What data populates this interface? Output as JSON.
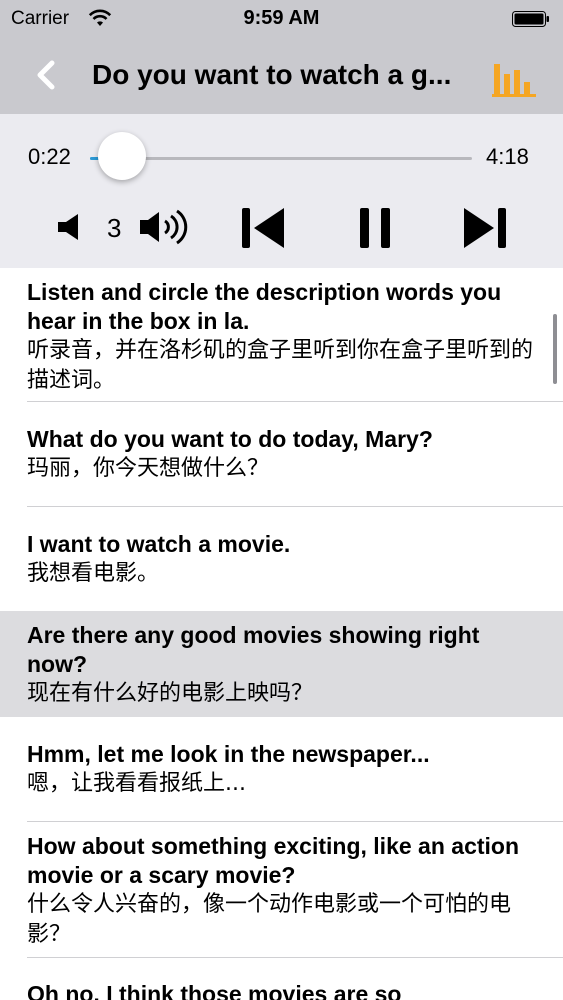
{
  "status_bar": {
    "carrier": "Carrier",
    "time": "9:59 AM"
  },
  "nav": {
    "title": "Do you want to watch a g...",
    "accent_color": "#f5a623"
  },
  "player": {
    "elapsed": "0:22",
    "total": "4:18",
    "progress": 0.085,
    "volume_level": "3"
  },
  "transcript": [
    {
      "en": "Listen and circle the description words you hear in the box in la.",
      "zh": "听录音，并在洛杉矶的盒子里听到你在盒子里听到的描述词。",
      "highlighted": false
    },
    {
      "en": "What do you want to do today, Mary?",
      "zh": "玛丽，你今天想做什么？",
      "highlighted": false
    },
    {
      "en": "I want to watch a movie.",
      "zh": "我想看电影。",
      "highlighted": false
    },
    {
      "en": "Are there any good movies showing right now?",
      "zh": "现在有什么好的电影上映吗？",
      "highlighted": true
    },
    {
      "en": "Hmm, let me look in the newspaper...",
      "zh": "嗯，让我看看报纸上...",
      "highlighted": false
    },
    {
      "en": "How about something exciting, like an action movie or a scary movie?",
      "zh": "什么令人兴奋的，像一个动作电影或一个可怕的电影？",
      "highlighted": false
    },
    {
      "en": "Oh no, I think those movies are so",
      "zh": "",
      "highlighted": false
    }
  ]
}
